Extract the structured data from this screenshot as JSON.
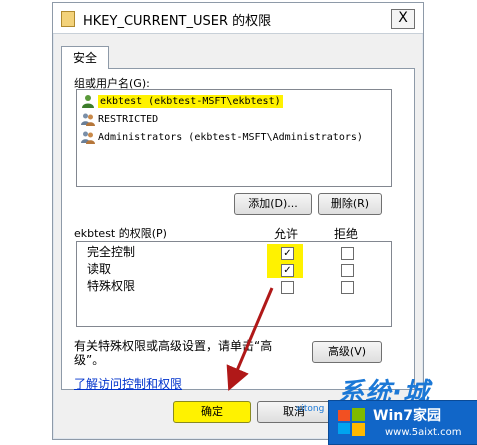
{
  "window": {
    "title": "HKEY_CURRENT_USER 的权限",
    "close_label": "X"
  },
  "tabs": [
    {
      "label": "安全"
    }
  ],
  "groups": {
    "label": "组或用户名(G):",
    "items": [
      {
        "label": "ekbtest (ekbtest-MSFT\\ekbtest)",
        "selected": true
      },
      {
        "label": "RESTRICTED",
        "selected": false
      },
      {
        "label": "Administrators (ekbtest-MSFT\\Administrators)",
        "selected": false
      }
    ],
    "add_button": "添加(D)...",
    "remove_button": "删除(R)"
  },
  "permissions": {
    "label": "ekbtest 的权限(P)",
    "allow_header": "允许",
    "deny_header": "拒绝",
    "rows": [
      {
        "name": "完全控制",
        "allow": true,
        "deny": false
      },
      {
        "name": "读取",
        "allow": true,
        "deny": false
      },
      {
        "name": "特殊权限",
        "allow": false,
        "deny": false
      }
    ]
  },
  "advanced": {
    "text_line1": "有关特殊权限或高级设置，请单击“高",
    "text_line2": "级”。",
    "button": "高级(V)"
  },
  "link": {
    "label": "了解访问控制和权限"
  },
  "footer": {
    "ok_button": "确定",
    "cancel_button": "取消"
  },
  "watermark": {
    "brand": "系统·城",
    "badge_title": "Win7家园",
    "badge_url": "www.5aixt.com",
    "small_text": "xitong"
  },
  "colors": {
    "highlight": "#fff200",
    "arrow": "#b01818",
    "badge": "#1166c8"
  }
}
